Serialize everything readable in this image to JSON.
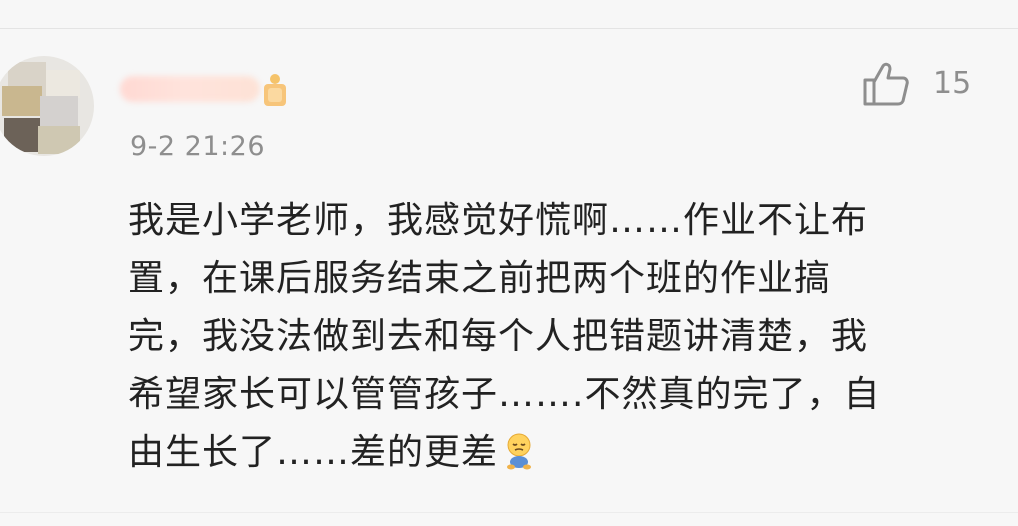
{
  "comment": {
    "username": "W?v...",
    "timestamp": "9-2 21:26",
    "like_count": "15",
    "body_lines": [
      "我是小学老师，我感觉好慌啊……作业不让布",
      "置，在课后服务结束之前把两个班的作业搞",
      "完，我没法做到去和每个人把错题讲清楚，我",
      "希望家长可以管管孩子…….不然真的完了，自",
      "由生长了……差的更差"
    ],
    "emoji": "sleepy-sitting-emoji",
    "icons": {
      "like": "thumbs-up-icon",
      "badge": "vip-badge-icon"
    },
    "colors": {
      "text": "#222222",
      "meta": "#8e8e8e",
      "background": "#f7f7f7"
    }
  }
}
